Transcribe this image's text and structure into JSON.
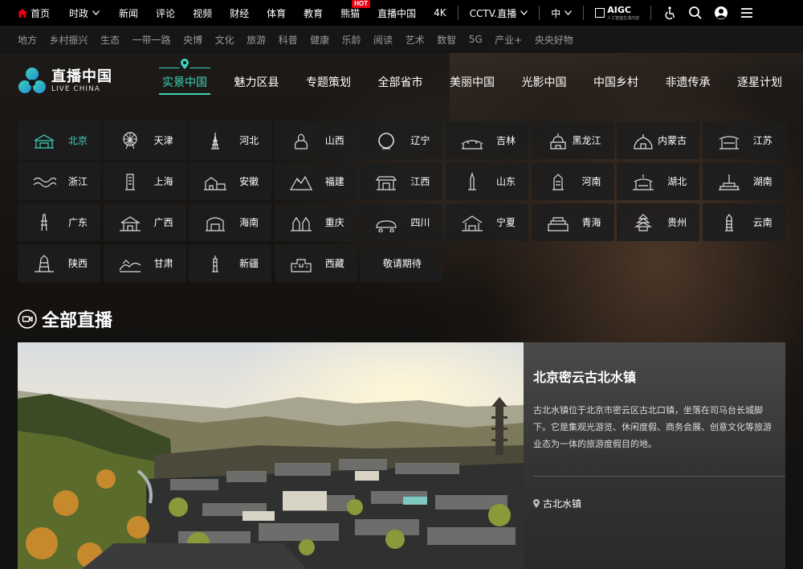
{
  "topbar": {
    "home": "首页",
    "politics": "时政",
    "news": "新闻",
    "comment": "评论",
    "video": "视频",
    "finance": "财经",
    "sports": "体育",
    "education": "教育",
    "panda": "熊猫",
    "hot": "HOT",
    "live_china": "直播中国",
    "fourk": "4K",
    "cctv_live": "CCTV.直播",
    "language": "中",
    "aigc": "AIGC",
    "aigc_sub": "人工智能生成内容"
  },
  "subbar": [
    "地方",
    "乡村振兴",
    "生态",
    "一带一路",
    "央博",
    "文化",
    "旅游",
    "科普",
    "健康",
    "乐龄",
    "阅读",
    "艺术",
    "数智",
    "5G",
    "产业+",
    "央央好物"
  ],
  "logo": {
    "cn": "直播中国",
    "en": "LIVE CHINA"
  },
  "nav": [
    "实景中国",
    "魅力区县",
    "专题策划",
    "全部省市",
    "美丽中国",
    "光影中国",
    "中国乡村",
    "非遗传承",
    "逐星计划"
  ],
  "provinces": [
    "北京",
    "天津",
    "河北",
    "山西",
    "辽宁",
    "吉林",
    "黑龙江",
    "内蒙古",
    "江苏",
    "浙江",
    "上海",
    "安徽",
    "福建",
    "江西",
    "山东",
    "河南",
    "湖北",
    "湖南",
    "广东",
    "广西",
    "海南",
    "重庆",
    "四川",
    "宁夏",
    "青海",
    "贵州",
    "云南",
    "陕西",
    "甘肃",
    "新疆",
    "西藏"
  ],
  "coming_soon": "敬请期待",
  "section": {
    "title": "全部直播"
  },
  "featured": {
    "title": "北京密云古北水镇",
    "desc": "古北水镇位于北京市密云区古北口镇，坐落在司马台长城脚下。它是集观光游览、休闲度假、商务会展、创意文化等旅游业态为一体的旅游度假目的地。",
    "location": "古北水镇"
  },
  "colors": {
    "accent": "#3fd2ba",
    "hot": "#e60012",
    "background": "#121212"
  }
}
